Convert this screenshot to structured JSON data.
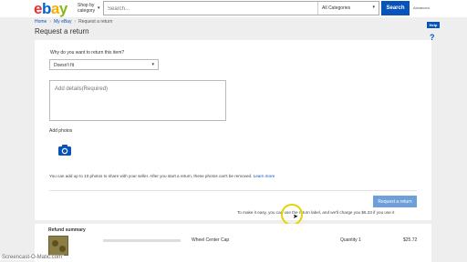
{
  "header": {
    "logo_letters": [
      "e",
      "b",
      "a",
      "y"
    ],
    "shop_by_line1": "Shop by",
    "shop_by_line2": "category",
    "search_placeholder": "Search...",
    "category_value": "All Categories",
    "search_button": "Search",
    "advanced_link": "Advanced"
  },
  "breadcrumb": {
    "home": "Home",
    "my_ebay": "My eBay",
    "current": "Request a return",
    "separator": "›"
  },
  "page_title": "Request a return",
  "help": {
    "button_label": "Help",
    "question_mark": "?"
  },
  "form": {
    "why_label": "Why do you want to return this item?",
    "reason_value": "Doesn't fit",
    "details_placeholder": "Add details(Required)",
    "add_photos_label": "Add photos",
    "photos_note": "You can add up to 10 photos to share with your seller. After you start a return, these photos can't be removed.",
    "learn_more": "Learn more",
    "return_button": "Request a return",
    "label_note": "To make it easy, you can use the return label, and we'll charge you $6.33 if you use it"
  },
  "refund_summary": {
    "title": "Refund summary",
    "item_name": "Wheel Center Cap",
    "quantity_label": "Quantity",
    "quantity_value": "1",
    "price": "$25.72"
  },
  "watermark": "Screencast-O-Matic.com",
  "colors": {
    "brand_blue": "#0654ba",
    "button_disabled_blue": "#6f9fd8",
    "page_bg": "#eeeeee",
    "cursor_highlight": "#e6d400"
  },
  "icons": {
    "camera": "camera-icon",
    "caret": "chevron-down-icon"
  }
}
